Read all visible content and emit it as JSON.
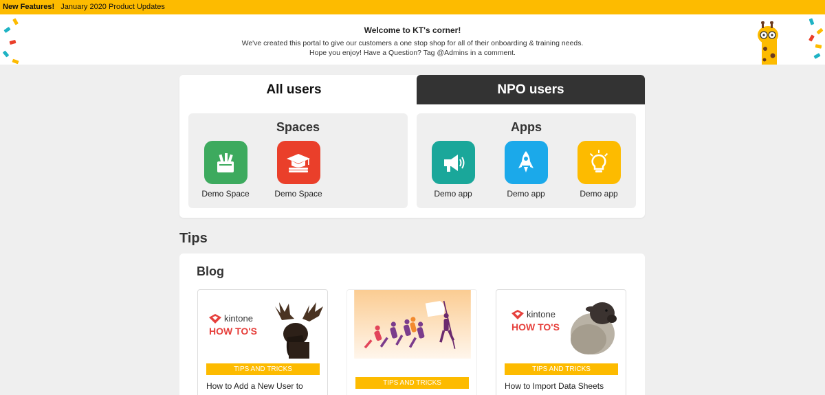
{
  "announcement": {
    "label": "New Features!",
    "text": "January 2020 Product Updates"
  },
  "welcome": {
    "title": "Welcome to KT's corner!",
    "line1": "We've created this portal to give our customers a one stop shop for all of their onboarding & training needs.",
    "line2": "Hope you enjoy! Have a Question? Tag @Admins in a comment."
  },
  "tabs": [
    {
      "label": "All users",
      "active": true
    },
    {
      "label": "NPO users",
      "active": false
    }
  ],
  "spaces": {
    "heading": "Spaces",
    "items": [
      {
        "label": "Demo Space",
        "icon": "toolbox-icon",
        "color": "#3daa5e"
      },
      {
        "label": "Demo Space",
        "icon": "graduation-cap-icon",
        "color": "#ea3f2a"
      }
    ]
  },
  "apps": {
    "heading": "Apps",
    "items": [
      {
        "label": "Demo app",
        "icon": "megaphone-icon",
        "color": "#1aa79a"
      },
      {
        "label": "Demo app",
        "icon": "rocket-icon",
        "color": "#1ba9ea"
      },
      {
        "label": "Demo app",
        "icon": "lightbulb-icon",
        "color": "#fdbb00"
      }
    ]
  },
  "tips": {
    "heading": "Tips",
    "blog_heading": "Blog",
    "posts": [
      {
        "brand": "kintone",
        "subtitle": "HOW TO'S",
        "tag": "TIPS AND TRICKS",
        "title": "How to Add a New User to"
      },
      {
        "tag": "TIPS AND TRICKS",
        "title": ""
      },
      {
        "brand": "kintone",
        "subtitle": "HOW TO'S",
        "tag": "TIPS AND TRICKS",
        "title": "How to Import Data Sheets"
      }
    ]
  },
  "colors": {
    "accent": "#fdbb00",
    "dark_tab": "#333333",
    "howto_red": "#e6403c"
  }
}
